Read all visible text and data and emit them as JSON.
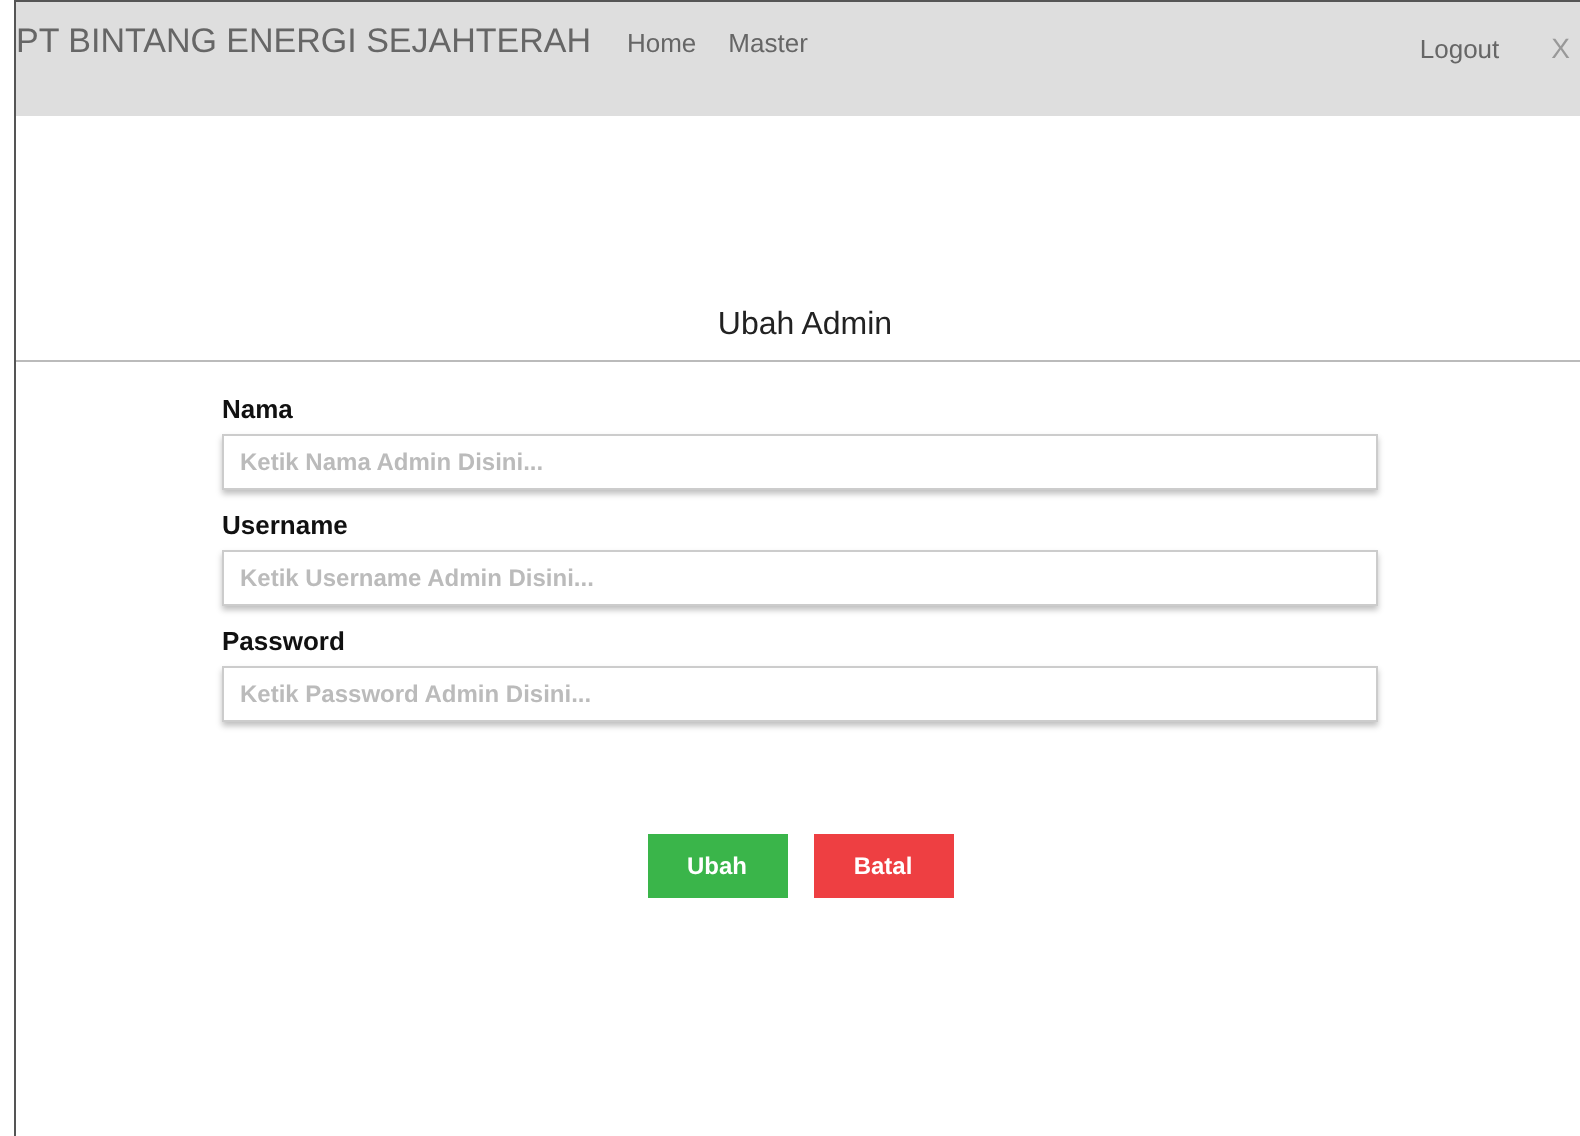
{
  "navbar": {
    "brand": "PT BINTANG ENERGI SEJAHTERAH",
    "links": [
      "Home",
      "Master"
    ],
    "logout": "Logout",
    "close": "X"
  },
  "form": {
    "title": "Ubah Admin",
    "fields": [
      {
        "label": "Nama",
        "placeholder": "Ketik Nama Admin Disini..."
      },
      {
        "label": "Username",
        "placeholder": "Ketik Username Admin Disini..."
      },
      {
        "label": "Password",
        "placeholder": "Ketik Password Admin Disini..."
      }
    ],
    "buttons": [
      {
        "label": "Ubah",
        "kind": "primary"
      },
      {
        "label": "Batal",
        "kind": "danger"
      }
    ]
  }
}
